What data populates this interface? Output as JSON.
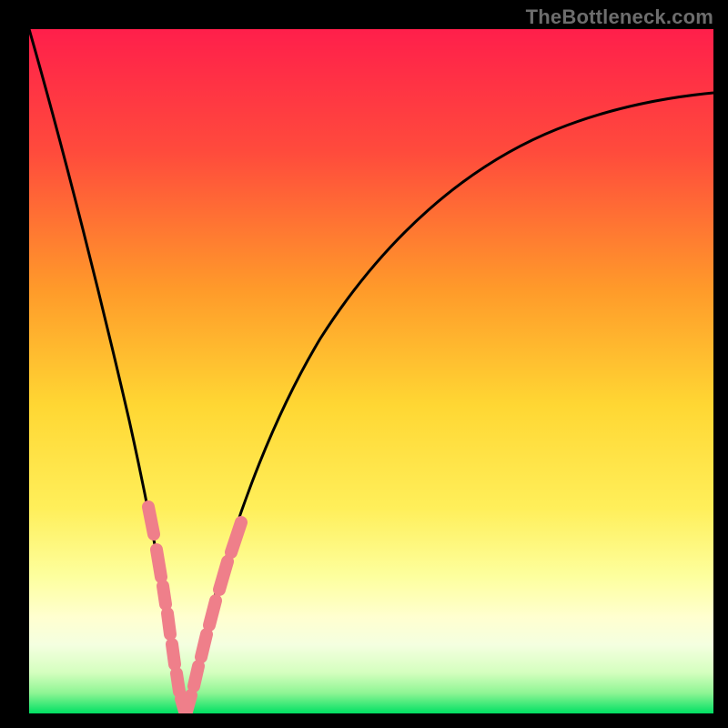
{
  "watermark": "TheBottleneck.com",
  "colors": {
    "frame": "#000000",
    "curve": "#000000",
    "band_overlay": "#ef7f8a",
    "grad_top": "#ff1f4b",
    "grad_mid_upper": "#ff8a2a",
    "grad_mid": "#ffe23a",
    "grad_lower": "#ffffa8",
    "grad_near_bottom": "#d5ffbf",
    "grad_bottom": "#00e063"
  },
  "chart_data": {
    "type": "line",
    "title": "",
    "xlabel": "",
    "ylabel": "",
    "xlim": [
      0,
      100
    ],
    "ylim": [
      0,
      100
    ],
    "note": "V-shaped bottleneck curve over a vertical red→orange→yellow→green gradient. Minimum (0%) near x≈22. Values approximate, read from the plot.",
    "series": [
      {
        "name": "curve_left",
        "x": [
          0,
          3,
          6,
          9,
          12,
          15,
          17,
          19,
          20,
          21,
          22
        ],
        "y": [
          100,
          86,
          73,
          59,
          45,
          32,
          22,
          13,
          8,
          3,
          0
        ]
      },
      {
        "name": "curve_right",
        "x": [
          22,
          24,
          26,
          28,
          31,
          35,
          40,
          46,
          53,
          61,
          70,
          80,
          90,
          100
        ],
        "y": [
          0,
          5,
          11,
          18,
          26,
          36,
          46,
          55,
          63,
          70,
          76,
          81,
          85,
          88
        ]
      }
    ],
    "overlay_bands": {
      "description": "Salmon rounded segments overlaid along the curve near the bottom (roughly y < 25%) on both arms of the V.",
      "left_arm_y_range": [
        3,
        25
      ],
      "right_arm_y_range": [
        0,
        23
      ]
    }
  }
}
